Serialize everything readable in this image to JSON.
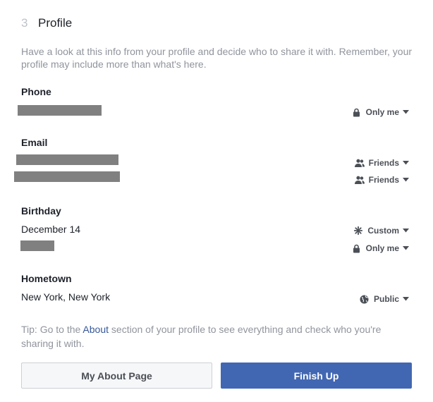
{
  "step": {
    "number": "3",
    "title": "Profile"
  },
  "intro": "Have a look at this info from your profile and decide who to share it with. Remember, your profile may include more than what's here.",
  "sections": {
    "phone": {
      "label": "Phone",
      "rows": [
        {
          "privacy": "Only me",
          "privacy_icon": "lock-icon"
        }
      ]
    },
    "email": {
      "label": "Email",
      "rows": [
        {
          "privacy": "Friends",
          "privacy_icon": "friends-icon"
        },
        {
          "privacy": "Friends",
          "privacy_icon": "friends-icon"
        }
      ]
    },
    "birthday": {
      "label": "Birthday",
      "rows": [
        {
          "value": "December 14",
          "privacy": "Custom",
          "privacy_icon": "gear-icon"
        },
        {
          "privacy": "Only me",
          "privacy_icon": "lock-icon"
        }
      ]
    },
    "hometown": {
      "label": "Hometown",
      "rows": [
        {
          "value": "New York, New York",
          "privacy": "Public",
          "privacy_icon": "globe-icon"
        }
      ]
    }
  },
  "tip": {
    "prefix": "Tip: Go to the ",
    "link": "About",
    "suffix": " section of your profile to see everything and check who you're sharing it with."
  },
  "buttons": {
    "secondary": "My About Page",
    "primary": "Finish Up"
  },
  "colors": {
    "primary": "#4267b2",
    "link": "#365899",
    "muted": "#90949c"
  }
}
